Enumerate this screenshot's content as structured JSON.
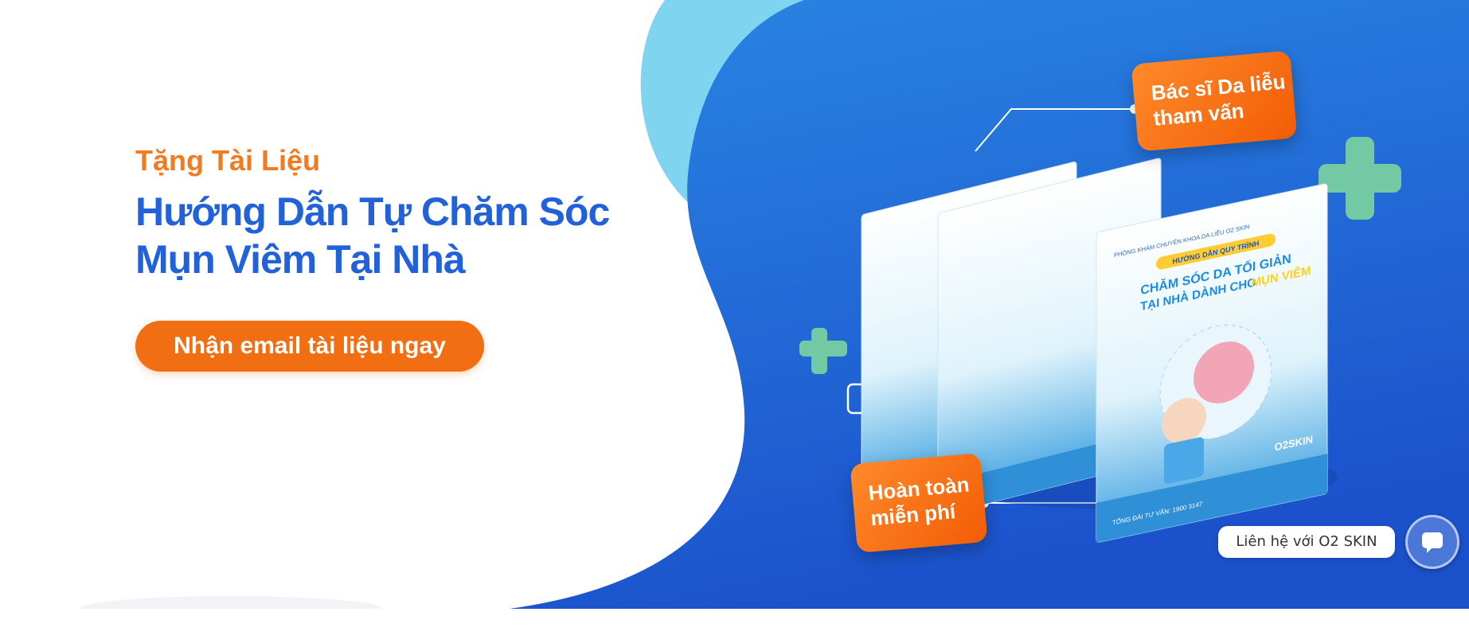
{
  "hero": {
    "eyebrow": "Tặng Tài Liệu",
    "title": "Hướng Dẫn Tự Chăm Sóc Mụn Viêm Tại Nhà",
    "cta_label": "Nhận email tài liệu ngay"
  },
  "callouts": {
    "top": "Bác sĩ Da liễu tham vấn",
    "bottom": "Hoàn toàn miễn phí"
  },
  "book": {
    "clinic": "PHÒNG KHÁM CHUYÊN KHOA DA LIỄU O2 SKIN",
    "badge": "HƯỚNG DẪN QUY TRÌNH",
    "title_line1": "CHĂM SÓC DA TỐI GIẢN",
    "title_line2": "TẠI NHÀ DÀNH CHO",
    "title_highlight": "MỤN VIÊM",
    "brand": "O2SKIN",
    "hotline": "TỔNG ĐÀI TƯ VẤN: 1900 3147"
  },
  "contact": {
    "label": "Liên hệ với O2 SKIN"
  },
  "colors": {
    "accent_orange": "#f26e12",
    "title_blue": "#2161d9",
    "panel_blue": "#1f62d6",
    "light_blue": "#7fd4f0",
    "cross_green": "#73c9a4"
  },
  "icons": [
    "plus-cross-icon",
    "chat-icon"
  ]
}
